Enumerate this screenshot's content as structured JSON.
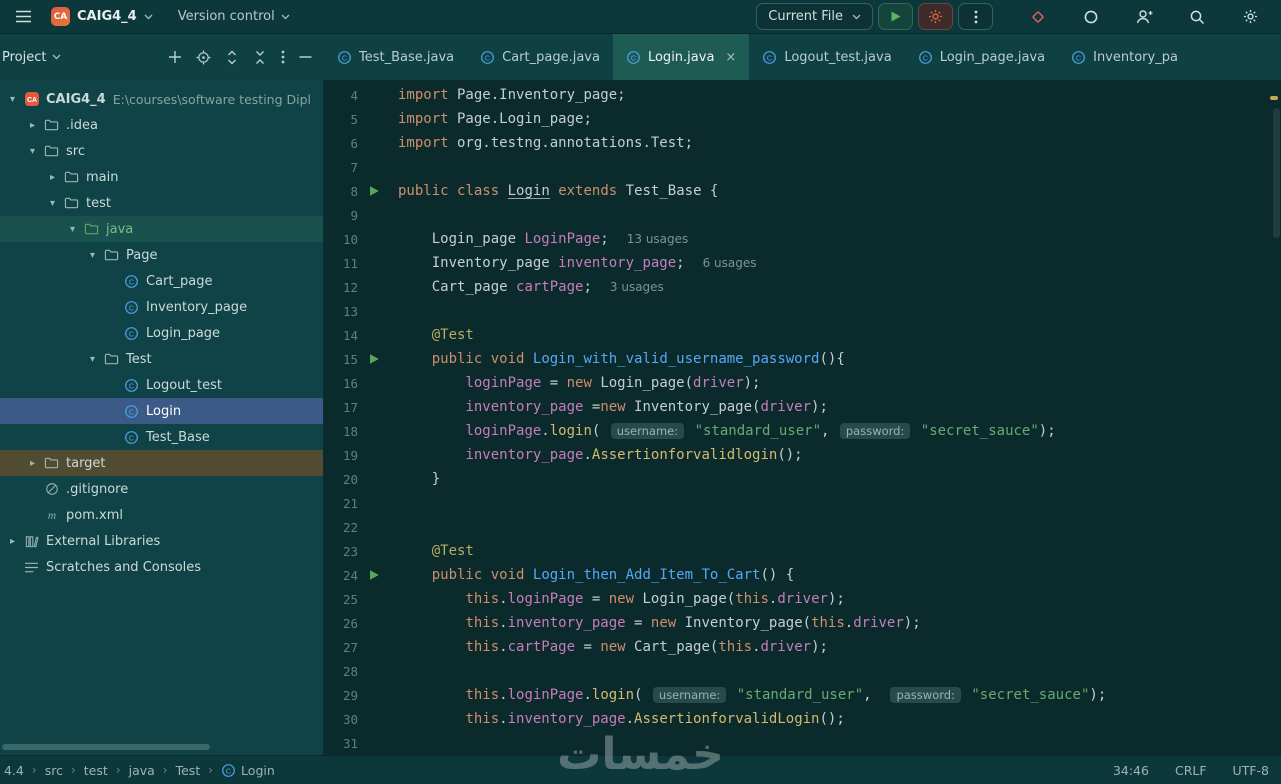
{
  "app": {
    "watermark": "خمسات"
  },
  "titlebar": {
    "project_badge": "CA",
    "project_name": "CAIG4_4",
    "version_control": "Version control",
    "run_config": "Current File"
  },
  "icons": {
    "hamburger": "≡",
    "chevron-down": "▾",
    "chevron-right": "▸",
    "run": "▶",
    "close": "×",
    "more": "⋮",
    "search": "magnifier",
    "settings": "gear",
    "class": "Ⓒ",
    "folder": "▭",
    "diamond": "◇",
    "ring": "◯",
    "user-plus": "👤+",
    "plus": "+",
    "minus": "—",
    "locate": "◎",
    "expand": "⇕",
    "collapse": "≍",
    "maven": "m",
    "gitignore": "⊘",
    "library": "⌸",
    "scratches": "≣"
  },
  "project_panel": {
    "title": "Project",
    "tree": [
      {
        "label": "CAIG4_4",
        "hint": "E:\\courses\\software testing Dipl",
        "indent": 0,
        "chevron": "down",
        "icon": "project",
        "bold": true
      },
      {
        "label": ".idea",
        "indent": 1,
        "chevron": "right",
        "icon": "folder"
      },
      {
        "label": "src",
        "indent": 1,
        "chevron": "down",
        "icon": "folder"
      },
      {
        "label": "main",
        "indent": 2,
        "chevron": "right",
        "icon": "folder"
      },
      {
        "label": "test",
        "indent": 2,
        "chevron": "down",
        "icon": "folder"
      },
      {
        "label": "java",
        "indent": 3,
        "chevron": "down",
        "icon": "folder-test",
        "highlight": "source"
      },
      {
        "label": "Page",
        "indent": 4,
        "chevron": "down",
        "icon": "folder"
      },
      {
        "label": "Cart_page",
        "indent": 5,
        "icon": "class"
      },
      {
        "label": "Inventory_page",
        "indent": 5,
        "icon": "class"
      },
      {
        "label": "Login_page",
        "indent": 5,
        "icon": "class"
      },
      {
        "label": "Test",
        "indent": 4,
        "chevron": "down",
        "icon": "folder"
      },
      {
        "label": "Logout_test",
        "indent": 5,
        "icon": "class"
      },
      {
        "label": "Login",
        "indent": 5,
        "icon": "class",
        "highlight": "selected"
      },
      {
        "label": "Test_Base",
        "indent": 5,
        "icon": "class"
      },
      {
        "label": "target",
        "indent": 1,
        "chevron": "right",
        "icon": "folder",
        "highlight": "excluded"
      },
      {
        "label": ".gitignore",
        "indent": 1,
        "icon": "gitignore"
      },
      {
        "label": "pom.xml",
        "indent": 1,
        "icon": "maven"
      },
      {
        "label": "External Libraries",
        "indent": 0,
        "chevron": "right",
        "icon": "library"
      },
      {
        "label": "Scratches and Consoles",
        "indent": 0,
        "icon": "scratches"
      }
    ]
  },
  "tabs": [
    {
      "label": "Test_Base.java"
    },
    {
      "label": "Cart_page.java"
    },
    {
      "label": "Login.java",
      "active": true
    },
    {
      "label": "Logout_test.java"
    },
    {
      "label": "Login_page.java"
    },
    {
      "label": "Inventory_pa"
    }
  ],
  "editor": {
    "lines": [
      {
        "n": 4,
        "seg": [
          [
            "import",
            "kw"
          ],
          [
            " Page.Inventory_page;",
            "pl"
          ]
        ]
      },
      {
        "n": 5,
        "seg": [
          [
            "import",
            "kw"
          ],
          [
            " Page.Login_page;",
            "pl"
          ]
        ]
      },
      {
        "n": 6,
        "seg": [
          [
            "import",
            "kw"
          ],
          [
            " org.testng.annotations.Test;",
            "pl"
          ]
        ]
      },
      {
        "n": 7,
        "seg": []
      },
      {
        "n": 8,
        "run": true,
        "seg": [
          [
            "public",
            "kw"
          ],
          [
            " ",
            "pl"
          ],
          [
            "class",
            "kw"
          ],
          [
            " ",
            "pl"
          ],
          [
            "Login",
            "ul"
          ],
          [
            " ",
            "pl"
          ],
          [
            "extends",
            "kw"
          ],
          [
            " Test_Base {",
            "pl"
          ]
        ]
      },
      {
        "n": 9,
        "seg": []
      },
      {
        "n": 10,
        "inlay": "13 usages",
        "seg": [
          [
            "    Login_page ",
            "pl"
          ],
          [
            "LoginPage",
            "fld"
          ],
          [
            ";",
            "pl"
          ]
        ]
      },
      {
        "n": 11,
        "inlay": "6 usages",
        "seg": [
          [
            "    Inventory_page ",
            "pl"
          ],
          [
            "inventory_page",
            "fld"
          ],
          [
            ";",
            "pl"
          ]
        ]
      },
      {
        "n": 12,
        "inlay": "3 usages",
        "seg": [
          [
            "    Cart_page ",
            "pl"
          ],
          [
            "cartPage",
            "fld"
          ],
          [
            ";",
            "pl"
          ]
        ]
      },
      {
        "n": 13,
        "seg": []
      },
      {
        "n": 14,
        "seg": [
          [
            "    ",
            "pl"
          ],
          [
            "@Test",
            "ann"
          ]
        ]
      },
      {
        "n": 15,
        "run": true,
        "seg": [
          [
            "    ",
            "pl"
          ],
          [
            "public",
            "kw"
          ],
          [
            " ",
            "pl"
          ],
          [
            "void",
            "kw"
          ],
          [
            " ",
            "pl"
          ],
          [
            "Login_with_valid_username_password",
            "mth"
          ],
          [
            "(){",
            "pl"
          ]
        ]
      },
      {
        "n": 16,
        "seg": [
          [
            "        ",
            "pl"
          ],
          [
            "loginPage",
            "fld"
          ],
          [
            " = ",
            "pl"
          ],
          [
            "new",
            "kw"
          ],
          [
            " Login_page(",
            "pl"
          ],
          [
            "driver",
            "fld"
          ],
          [
            ");",
            "pl"
          ]
        ]
      },
      {
        "n": 17,
        "seg": [
          [
            "        ",
            "pl"
          ],
          [
            "inventory_page",
            "fld"
          ],
          [
            " =",
            "pl"
          ],
          [
            "new",
            "kw"
          ],
          [
            " Inventory_page(",
            "pl"
          ],
          [
            "driver",
            "fld"
          ],
          [
            ");",
            "pl"
          ]
        ]
      },
      {
        "n": 18,
        "seg": [
          [
            "        ",
            "pl"
          ],
          [
            "loginPage",
            "fld"
          ],
          [
            ".",
            "pl"
          ],
          [
            "login",
            "call"
          ],
          [
            "( ",
            "pl"
          ],
          [
            "username:",
            "hint"
          ],
          [
            " ",
            "pl"
          ],
          [
            "\"standard_user\"",
            "str"
          ],
          [
            ", ",
            "pl"
          ],
          [
            "password:",
            "hint"
          ],
          [
            " ",
            "pl"
          ],
          [
            "\"secret_sauce\"",
            "str"
          ],
          [
            ");",
            "pl"
          ]
        ]
      },
      {
        "n": 19,
        "seg": [
          [
            "        ",
            "pl"
          ],
          [
            "inventory_page",
            "fld"
          ],
          [
            ".",
            "pl"
          ],
          [
            "Assertionforvalidlogin",
            "call"
          ],
          [
            "();",
            "pl"
          ]
        ]
      },
      {
        "n": 20,
        "seg": [
          [
            "    }",
            "pl"
          ]
        ]
      },
      {
        "n": 21,
        "seg": []
      },
      {
        "n": 22,
        "seg": []
      },
      {
        "n": 23,
        "seg": [
          [
            "    ",
            "pl"
          ],
          [
            "@Test",
            "ann"
          ]
        ]
      },
      {
        "n": 24,
        "run": true,
        "seg": [
          [
            "    ",
            "pl"
          ],
          [
            "public",
            "kw"
          ],
          [
            " ",
            "pl"
          ],
          [
            "void",
            "kw"
          ],
          [
            " ",
            "pl"
          ],
          [
            "Login_then_Add_Item_To_Cart",
            "mth"
          ],
          [
            "() {",
            "pl"
          ]
        ]
      },
      {
        "n": 25,
        "seg": [
          [
            "        ",
            "pl"
          ],
          [
            "this",
            "kw"
          ],
          [
            ".",
            "pl"
          ],
          [
            "loginPage",
            "fld"
          ],
          [
            " = ",
            "pl"
          ],
          [
            "new",
            "kw"
          ],
          [
            " Login_page(",
            "pl"
          ],
          [
            "this",
            "kw"
          ],
          [
            ".",
            "pl"
          ],
          [
            "driver",
            "fld"
          ],
          [
            ");",
            "pl"
          ]
        ]
      },
      {
        "n": 26,
        "seg": [
          [
            "        ",
            "pl"
          ],
          [
            "this",
            "kw"
          ],
          [
            ".",
            "pl"
          ],
          [
            "inventory_page",
            "fld"
          ],
          [
            " = ",
            "pl"
          ],
          [
            "new",
            "kw"
          ],
          [
            " Inventory_page(",
            "pl"
          ],
          [
            "this",
            "kw"
          ],
          [
            ".",
            "pl"
          ],
          [
            "driver",
            "fld"
          ],
          [
            ");",
            "pl"
          ]
        ]
      },
      {
        "n": 27,
        "seg": [
          [
            "        ",
            "pl"
          ],
          [
            "this",
            "kw"
          ],
          [
            ".",
            "pl"
          ],
          [
            "cartPage",
            "fld"
          ],
          [
            " = ",
            "pl"
          ],
          [
            "new",
            "kw"
          ],
          [
            " Cart_page(",
            "pl"
          ],
          [
            "this",
            "kw"
          ],
          [
            ".",
            "pl"
          ],
          [
            "driver",
            "fld"
          ],
          [
            ");",
            "pl"
          ]
        ]
      },
      {
        "n": 28,
        "seg": []
      },
      {
        "n": 29,
        "seg": [
          [
            "        ",
            "pl"
          ],
          [
            "this",
            "kw"
          ],
          [
            ".",
            "pl"
          ],
          [
            "loginPage",
            "fld"
          ],
          [
            ".",
            "pl"
          ],
          [
            "login",
            "call"
          ],
          [
            "( ",
            "pl"
          ],
          [
            "username:",
            "hint"
          ],
          [
            " ",
            "pl"
          ],
          [
            "\"standard_user\"",
            "str"
          ],
          [
            ",  ",
            "pl"
          ],
          [
            "password:",
            "hint"
          ],
          [
            " ",
            "pl"
          ],
          [
            "\"secret_sauce\"",
            "str"
          ],
          [
            ");",
            "pl"
          ]
        ]
      },
      {
        "n": 30,
        "seg": [
          [
            "        ",
            "pl"
          ],
          [
            "this",
            "kw"
          ],
          [
            ".",
            "pl"
          ],
          [
            "inventory_page",
            "fld"
          ],
          [
            ".",
            "pl"
          ],
          [
            "AssertionforvalidLogin",
            "call"
          ],
          [
            "();",
            "pl"
          ]
        ]
      },
      {
        "n": 31,
        "seg": []
      }
    ]
  },
  "status_bar": {
    "breadcrumbs": [
      "4.4",
      "src",
      "test",
      "java",
      "Test",
      "Login"
    ],
    "cursor_position": "34:46",
    "line_separator": "CRLF",
    "encoding": "UTF-8"
  }
}
